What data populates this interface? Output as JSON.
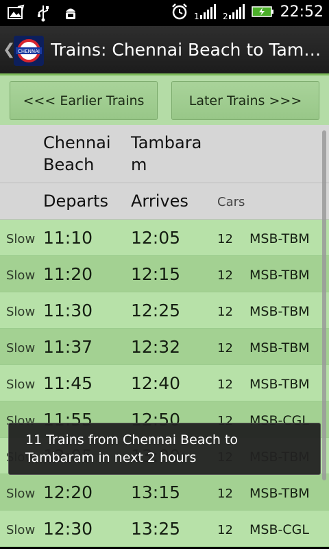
{
  "status_bar": {
    "time": "22:52",
    "icons": [
      "image-icon",
      "usb-icon",
      "android-debug-icon",
      "alarm-icon",
      "signal-1-icon",
      "signal-2-icon",
      "battery-charging-icon"
    ]
  },
  "title_bar": {
    "title": "Trains: Chennai Beach to Tambaram",
    "logo_text": "CHENNAI"
  },
  "buttons": {
    "earlier": "<<< Earlier Trains",
    "later": "Later Trains >>>"
  },
  "header": {
    "from_station": "Chennai Beach",
    "to_station_line1": "Tambara",
    "to_station_line2": "m",
    "from_line1": "Chennai",
    "from_line2": "Beach",
    "departs": "Departs",
    "arrives": "Arrives",
    "cars": "Cars"
  },
  "trains": [
    {
      "type": "Slow",
      "departs": "11:10",
      "arrives": "12:05",
      "cars": "12",
      "route": "MSB-TBM"
    },
    {
      "type": "Slow",
      "departs": "11:20",
      "arrives": "12:15",
      "cars": "12",
      "route": "MSB-TBM"
    },
    {
      "type": "Slow",
      "departs": "11:30",
      "arrives": "12:25",
      "cars": "12",
      "route": "MSB-TBM"
    },
    {
      "type": "Slow",
      "departs": "11:37",
      "arrives": "12:32",
      "cars": "12",
      "route": "MSB-TBM"
    },
    {
      "type": "Slow",
      "departs": "11:45",
      "arrives": "12:40",
      "cars": "12",
      "route": "MSB-TBM"
    },
    {
      "type": "Slow",
      "departs": "11:55",
      "arrives": "12:50",
      "cars": "12",
      "route": "MSB-CGL"
    },
    {
      "type": "Slow",
      "departs": "12:05",
      "arrives": "13:00",
      "cars": "12",
      "route": "MSB-TBM"
    },
    {
      "type": "Slow",
      "departs": "12:20",
      "arrives": "13:15",
      "cars": "12",
      "route": "MSB-TBM"
    },
    {
      "type": "Slow",
      "departs": "12:30",
      "arrives": "13:25",
      "cars": "12",
      "route": "MSB-CGL"
    }
  ],
  "toast": {
    "message": "11 Trains from Chennai Beach to Tambaram in next 2 hours"
  },
  "colors": {
    "row_light": "#b7e1a8",
    "row_dark": "#a3d192",
    "header_gray": "#d6d6d6",
    "accent_green": "#7dbb5a"
  }
}
